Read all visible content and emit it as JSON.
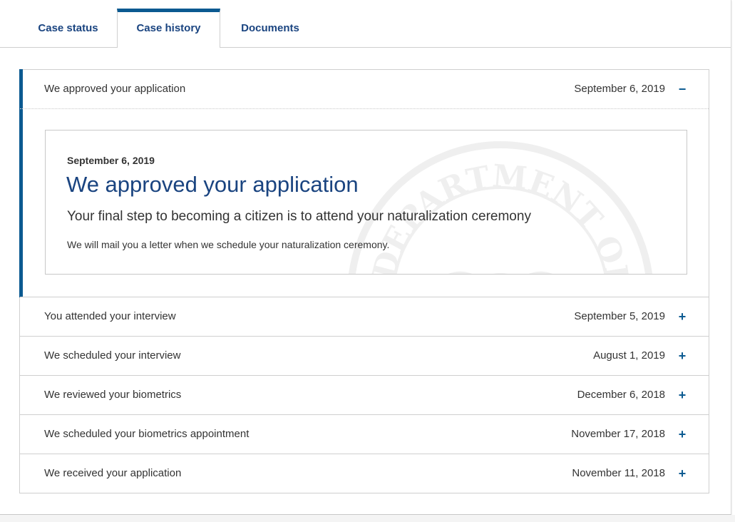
{
  "tabs": [
    {
      "label": "Case status"
    },
    {
      "label": "Case history"
    },
    {
      "label": "Documents"
    }
  ],
  "active_tab": "Case history",
  "history": {
    "open_item": {
      "title": "We approved your application",
      "date": "September 6, 2019",
      "toggle": "−",
      "detail": {
        "date": "September 6, 2019",
        "heading": "We approved your application",
        "subheading": "Your final step to becoming a citizen is to attend your naturalization ceremony",
        "body": "We will mail you a letter when we schedule your naturalization ceremony.",
        "watermark_text": "DEPARTMENT OF"
      }
    },
    "items": [
      {
        "title": "You attended your interview",
        "date": "September 5, 2019",
        "toggle": "+"
      },
      {
        "title": "We scheduled your interview",
        "date": "August 1, 2019",
        "toggle": "+"
      },
      {
        "title": "We reviewed your biometrics",
        "date": "December 6, 2018",
        "toggle": "+"
      },
      {
        "title": "We scheduled your biometrics appointment",
        "date": "November 17, 2018",
        "toggle": "+"
      },
      {
        "title": "We received your application",
        "date": "November 11, 2018",
        "toggle": "+"
      }
    ]
  },
  "colors": {
    "accent": "#0b5a91",
    "link": "#1a4480",
    "border": "#cfcfcf"
  }
}
